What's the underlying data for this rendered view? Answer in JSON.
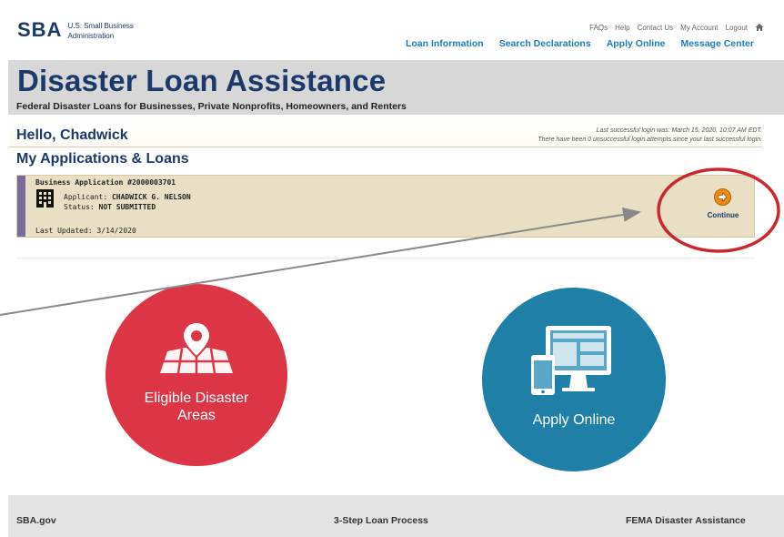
{
  "header": {
    "logo_mark": "SBA",
    "logo_line1": "U.S. Small Business",
    "logo_line2": "Administration",
    "util_nav": [
      "FAQs",
      "Help",
      "Contact Us",
      "My Account",
      "Logout"
    ],
    "main_nav": [
      "Loan Information",
      "Search Declarations",
      "Apply Online",
      "Message Center"
    ]
  },
  "banner": {
    "title": "Disaster Loan Assistance",
    "subtitle": "Federal Disaster Loans for Businesses, Private Nonprofits, Homeowners, and Renters"
  },
  "greeting": {
    "hello": "Hello, Chadwick",
    "last_login": "Last successful login was: March 15, 2020, 10:07 AM EDT.",
    "attempts": "There have been 0 unsuccessful login attempts since your last successful login."
  },
  "applications": {
    "section_title": "My Applications & Loans",
    "card": {
      "title": "Business Application #2000003701",
      "applicant_label": "Applicant: ",
      "applicant_value": "CHADWICK G. NELSON",
      "status_label": "Status: ",
      "status_value": "NOT SUBMITTED",
      "updated": "Last Updated: 3/14/2020",
      "continue_label": "Continue"
    }
  },
  "tiles": {
    "eligible": [
      "Eligible Disaster",
      "Areas"
    ],
    "apply": "Apply Online"
  },
  "footer": {
    "left": "SBA.gov",
    "center": "3-Step Loan Process",
    "right": "FEMA Disaster Assistance"
  },
  "colors": {
    "brand_navy": "#1b3a6b",
    "nav_blue": "#1a7bbf",
    "eligible_red": "#dc3546",
    "apply_teal": "#1f7fa6",
    "card_tan": "#e8dfc4",
    "annotation_red": "#c8282e"
  }
}
